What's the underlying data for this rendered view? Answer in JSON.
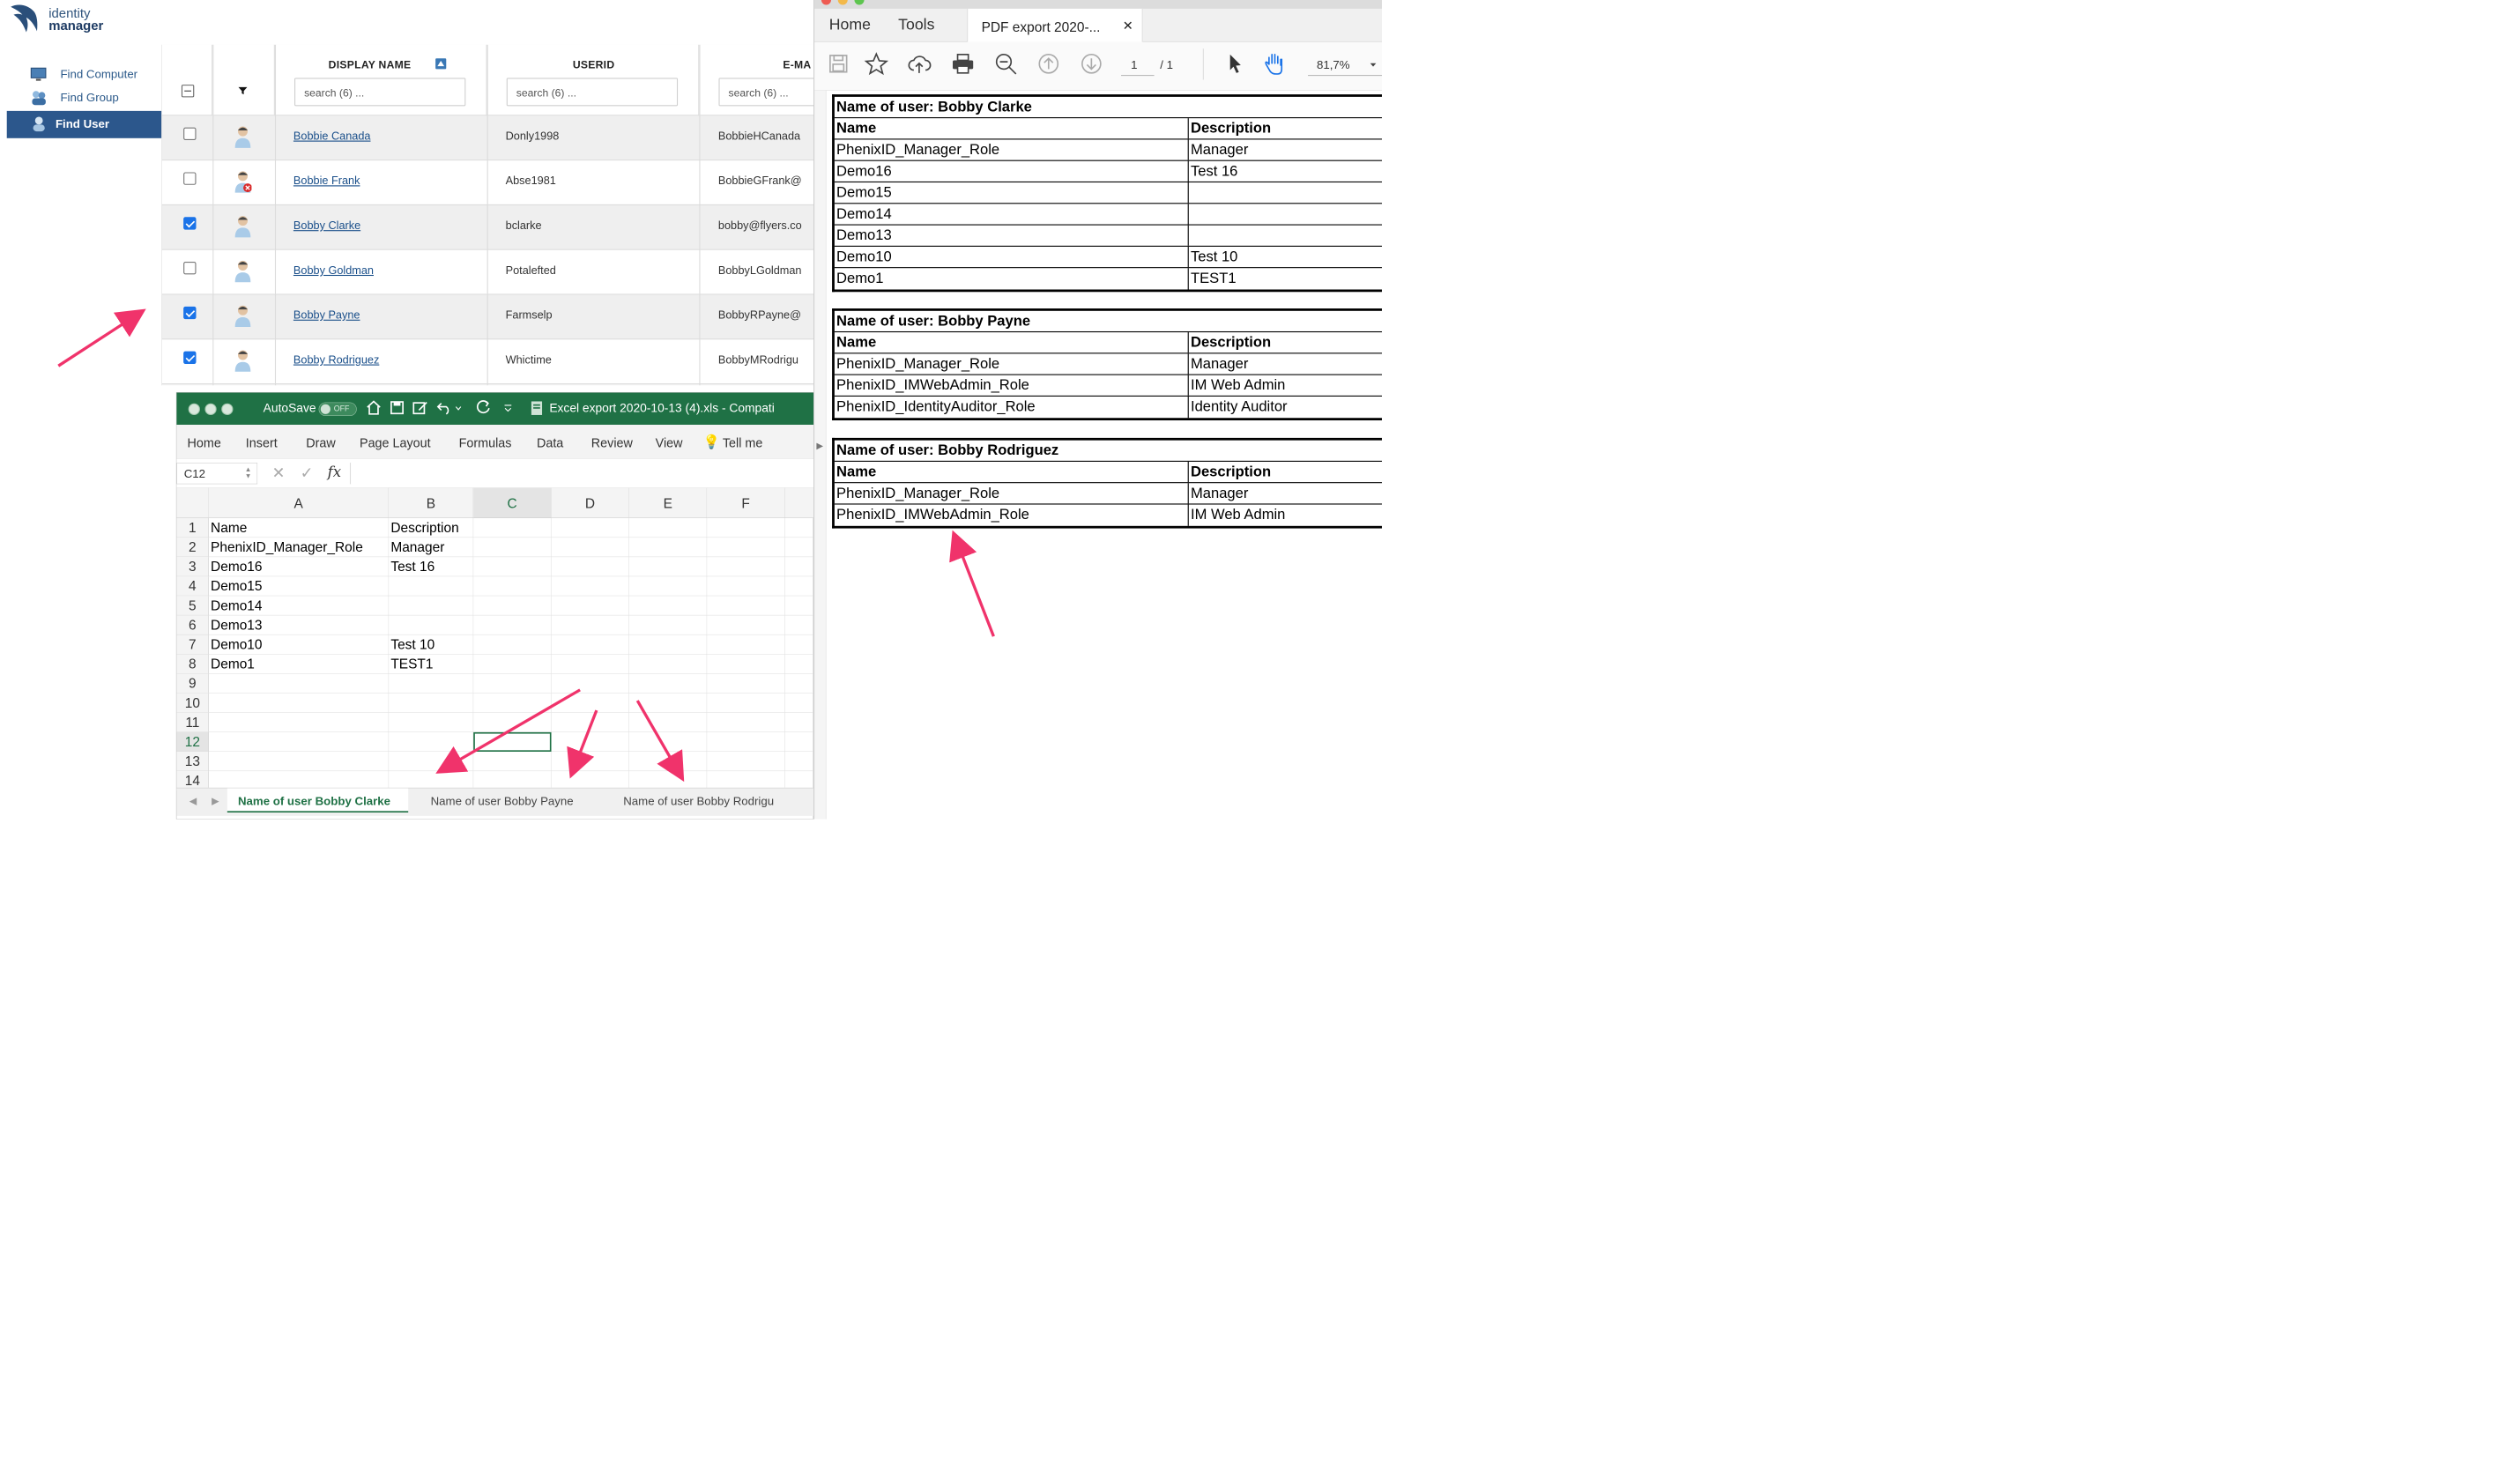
{
  "identity_manager": {
    "logo": {
      "line1": "identity",
      "line2": "manager"
    },
    "sidebar": [
      {
        "label": "Find Computer",
        "icon": "computer-icon",
        "active": false
      },
      {
        "label": "Find Group",
        "icon": "group-icon",
        "active": false
      },
      {
        "label": "Find User",
        "icon": "user-icon",
        "active": true
      }
    ],
    "grid": {
      "columns": [
        "DISPLAY NAME",
        "USERID",
        "E-MA"
      ],
      "search_placeholders": [
        "search (6) ...",
        "search (6) ...",
        "search (6) ..."
      ],
      "rows": [
        {
          "checked": false,
          "status": "active",
          "display_name": "Bobbie Canada",
          "userid": "Donly1998",
          "email": "BobbieHCanada"
        },
        {
          "checked": false,
          "status": "disabled",
          "display_name": "Bobbie Frank",
          "userid": "Abse1981",
          "email": "BobbieGFrank@"
        },
        {
          "checked": true,
          "status": "active",
          "display_name": "Bobby Clarke",
          "userid": "bclarke",
          "email": "bobby@flyers.co"
        },
        {
          "checked": false,
          "status": "active",
          "display_name": "Bobby Goldman",
          "userid": "Potalefted",
          "email": "BobbyLGoldman"
        },
        {
          "checked": true,
          "status": "active",
          "display_name": "Bobby Payne",
          "userid": "Farmselp",
          "email": "BobbyRPayne@"
        },
        {
          "checked": true,
          "status": "active",
          "display_name": "Bobby Rodriguez",
          "userid": "Whictime",
          "email": "BobbyMRodrigu"
        }
      ]
    }
  },
  "excel": {
    "autosave_label": "AutoSave",
    "autosave_state": "OFF",
    "title": "Excel export 2020-10-13 (4).xls  -  Compati",
    "menu": [
      "Home",
      "Insert",
      "Draw",
      "Page Layout",
      "Formulas",
      "Data",
      "Review",
      "View",
      "Tell me"
    ],
    "name_box": "C12",
    "fx_label": "fx",
    "columns": [
      "A",
      "B",
      "C",
      "D",
      "E",
      "F"
    ],
    "row_numbers": [
      "1",
      "2",
      "3",
      "4",
      "5",
      "6",
      "7",
      "8",
      "9",
      "10",
      "11",
      "12",
      "13",
      "14"
    ],
    "cells": [
      [
        "Name",
        "Description"
      ],
      [
        "PhenixID_Manager_Role",
        "Manager"
      ],
      [
        "Demo16",
        "Test 16"
      ],
      [
        "Demo15",
        ""
      ],
      [
        "Demo14",
        ""
      ],
      [
        "Demo13",
        ""
      ],
      [
        "Demo10",
        "Test 10"
      ],
      [
        "Demo1",
        "TEST1"
      ]
    ],
    "sheet_tabs": [
      "Name of user  Bobby Clarke",
      "Name of user  Bobby Payne",
      "Name of user  Bobby Rodrigu"
    ],
    "active_sheet": 0
  },
  "pdf": {
    "tabs": [
      "Home",
      "Tools"
    ],
    "doc_tab": "PDF export 2020-...",
    "page_current": "1",
    "page_total": "/ 1",
    "zoom": "81,7%",
    "tables": [
      {
        "title": "Name of user: Bobby Clarke",
        "header": [
          "Name",
          "Description"
        ],
        "rows": [
          [
            "PhenixID_Manager_Role",
            "Manager"
          ],
          [
            "Demo16",
            "Test 16"
          ],
          [
            "Demo15",
            ""
          ],
          [
            "Demo14",
            ""
          ],
          [
            "Demo13",
            ""
          ],
          [
            "Demo10",
            "Test 10"
          ],
          [
            "Demo1",
            "TEST1"
          ]
        ]
      },
      {
        "title": "Name of user: Bobby Payne",
        "header": [
          "Name",
          "Description"
        ],
        "rows": [
          [
            "PhenixID_Manager_Role",
            "Manager"
          ],
          [
            "PhenixID_IMWebAdmin_Role",
            "IM Web Admin"
          ],
          [
            "PhenixID_IdentityAuditor_Role",
            "Identity Auditor"
          ]
        ]
      },
      {
        "title": "Name of user: Bobby Rodriguez",
        "header": [
          "Name",
          "Description"
        ],
        "rows": [
          [
            "PhenixID_Manager_Role",
            "Manager"
          ],
          [
            "PhenixID_IMWebAdmin_Role",
            "IM Web Admin"
          ]
        ]
      }
    ]
  },
  "colors": {
    "excel_green": "#1f7145",
    "sidebar_active": "#2c578c",
    "annotation_arrow": "#f0336b"
  }
}
